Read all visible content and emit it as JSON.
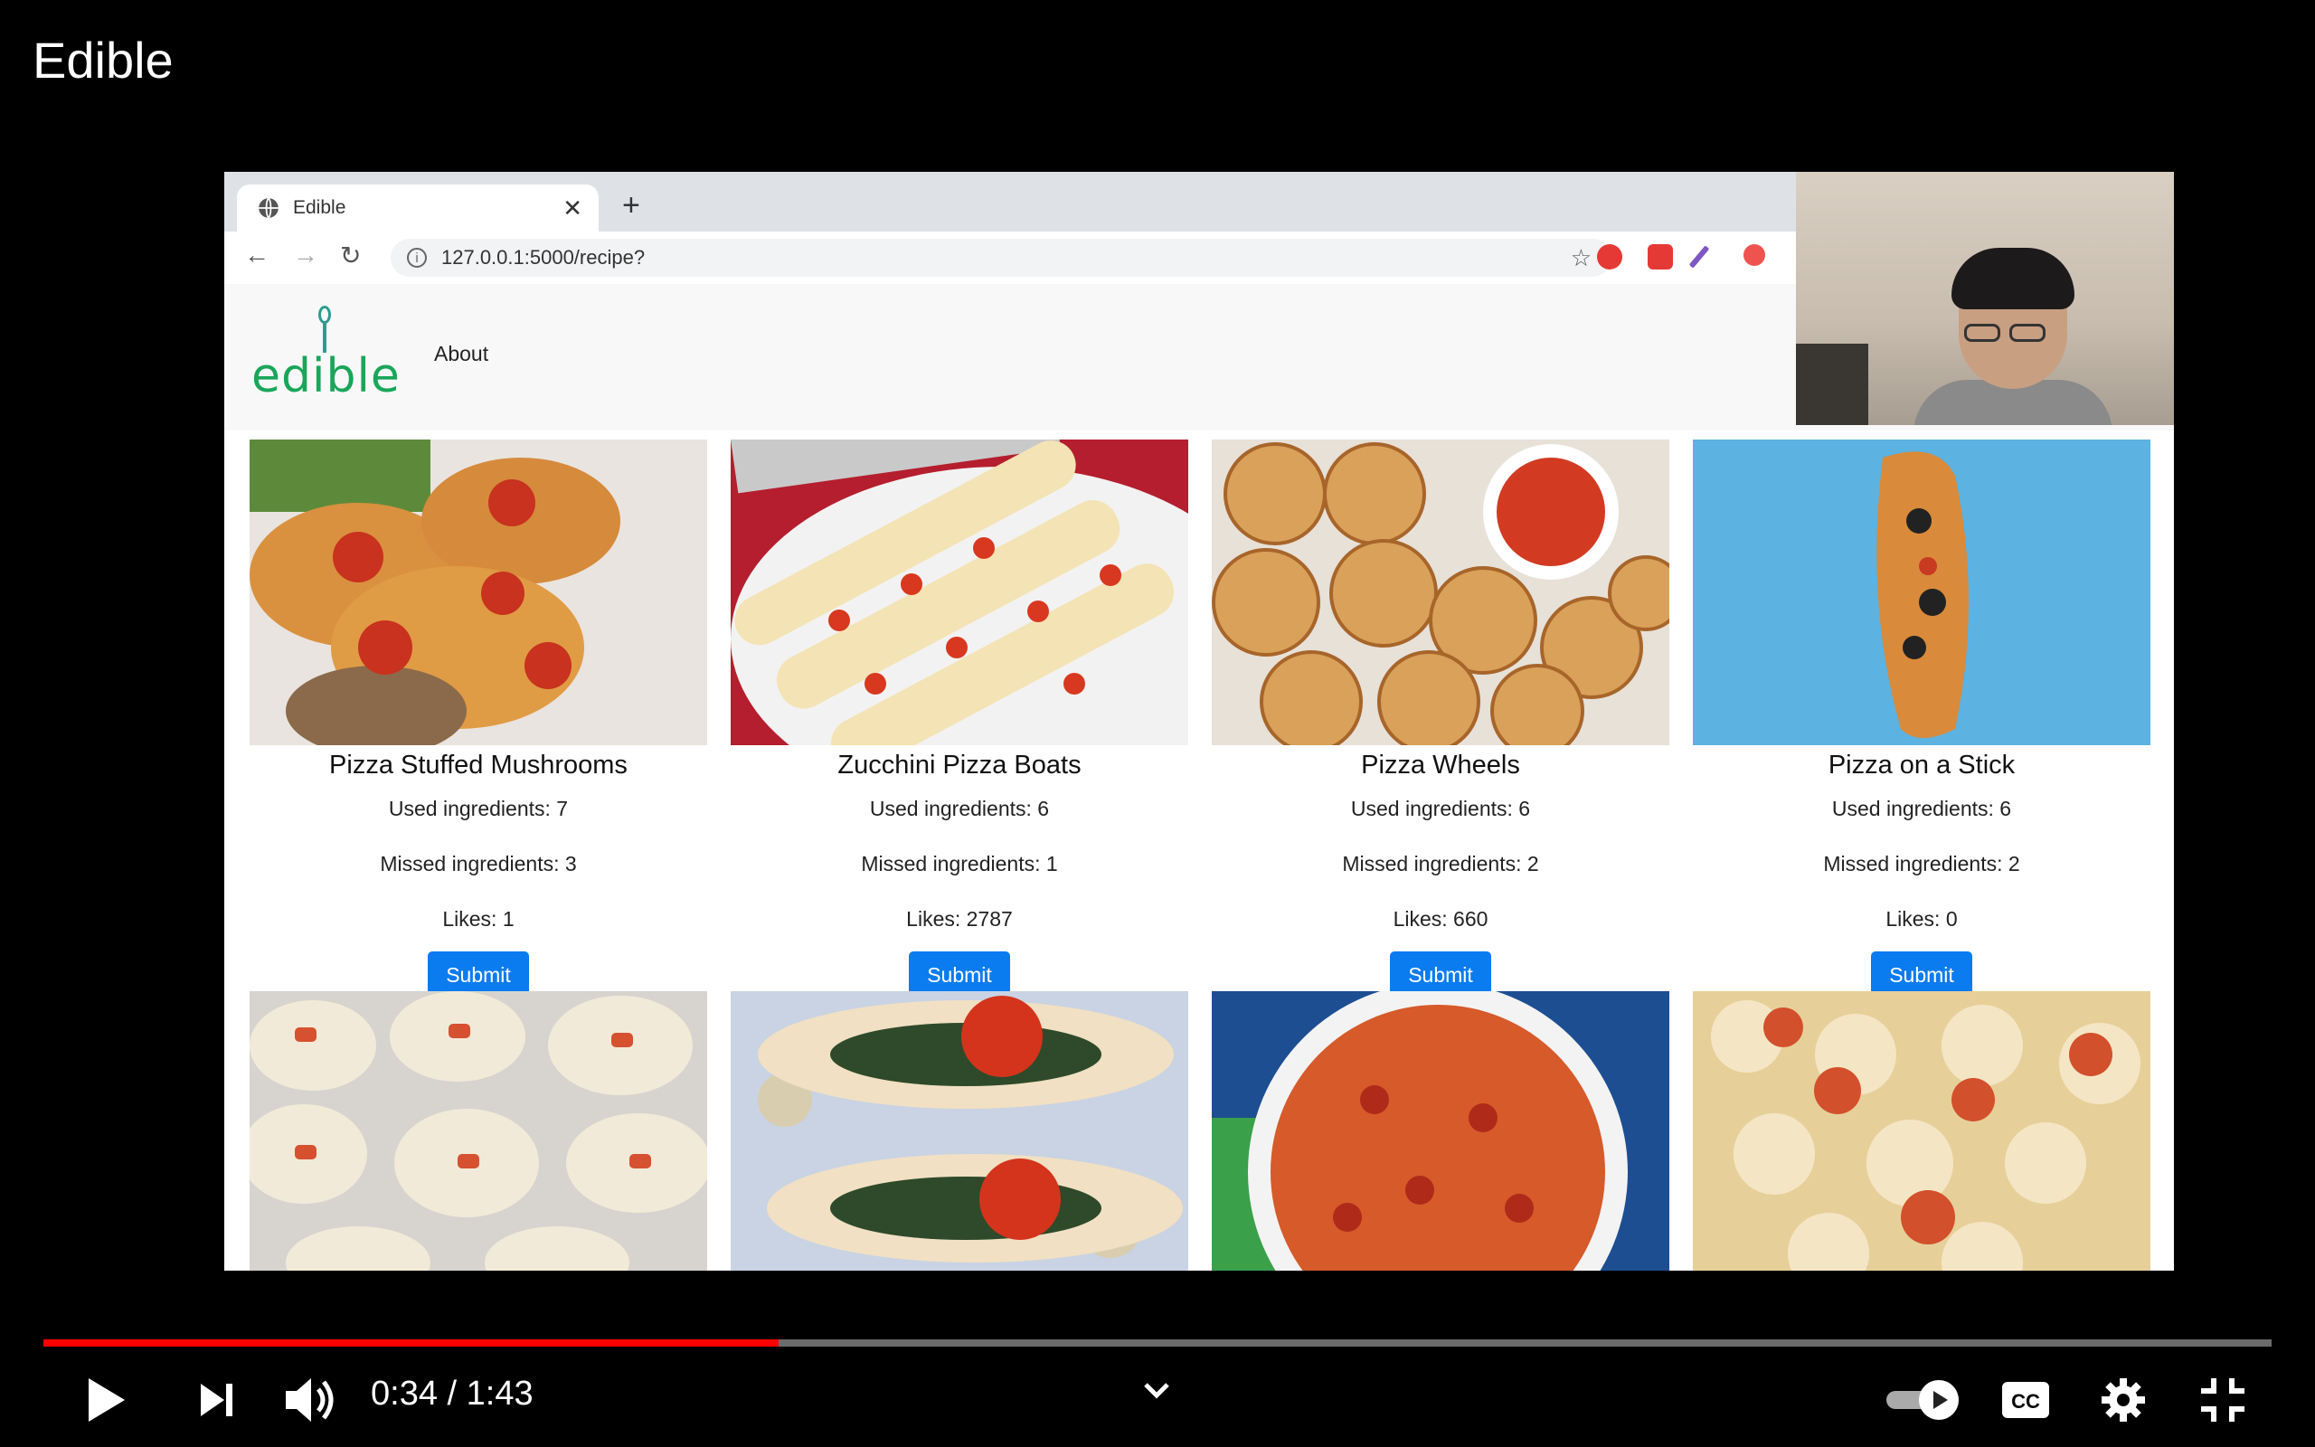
{
  "video": {
    "title": "Edible"
  },
  "browser": {
    "tab_title": "Edible",
    "url": "127.0.0.1:5000/recipe?"
  },
  "site": {
    "logo_text": "edible",
    "nav_about": "About",
    "submit_label": "Submit"
  },
  "recipes": [
    {
      "title": "Pizza Stuffed Mushrooms",
      "used": "Used ingredients: 7",
      "missed": "Missed ingredients: 3",
      "likes": "Likes: 1"
    },
    {
      "title": "Zucchini Pizza Boats",
      "used": "Used ingredients: 6",
      "missed": "Missed ingredients: 1",
      "likes": "Likes: 2787"
    },
    {
      "title": "Pizza Wheels",
      "used": "Used ingredients: 6",
      "missed": "Missed ingredients: 2",
      "likes": "Likes: 660"
    },
    {
      "title": "Pizza on a Stick",
      "used": "Used ingredients: 6",
      "missed": "Missed ingredients: 2",
      "likes": "Likes: 0"
    }
  ],
  "player": {
    "time_display": "0:34 / 1:43",
    "progress_fraction": 0.33,
    "icons": [
      "play-icon",
      "next-icon",
      "volume-icon",
      "chevron-down-icon",
      "autoplay-toggle-icon",
      "captions-icon",
      "settings-icon",
      "exit-fullscreen-icon"
    ]
  },
  "colors": {
    "brand_green": "#1aa65a",
    "submit_blue": "#0a7cf0",
    "progress_red": "#ff0000"
  }
}
